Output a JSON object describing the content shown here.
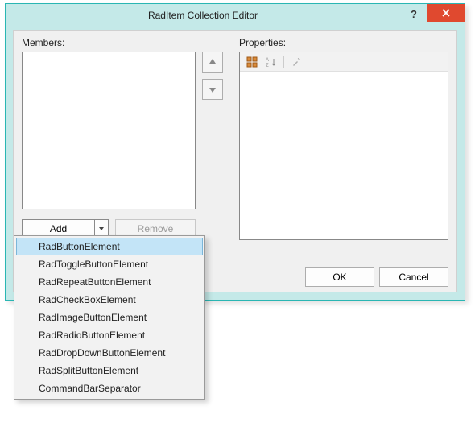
{
  "window": {
    "title": "RadItem Collection Editor"
  },
  "labels": {
    "members": "Members:",
    "properties": "Properties:"
  },
  "buttons": {
    "add": "Add",
    "remove": "Remove",
    "ok": "OK",
    "cancel": "Cancel"
  },
  "dropdown": {
    "items": [
      "RadButtonElement",
      "RadToggleButtonElement",
      "RadRepeatButtonElement",
      "RadCheckBoxElement",
      "RadImageButtonElement",
      "RadRadioButtonElement",
      "RadDropDownButtonElement",
      "RadSplitButtonElement",
      "CommandBarSeparator"
    ],
    "highlighted_index": 0
  },
  "colors": {
    "titlebar": "#c4e9e8",
    "close": "#e0492f",
    "accent_border": "#2ab6b3",
    "menu_hover": "#c3e4f7"
  }
}
